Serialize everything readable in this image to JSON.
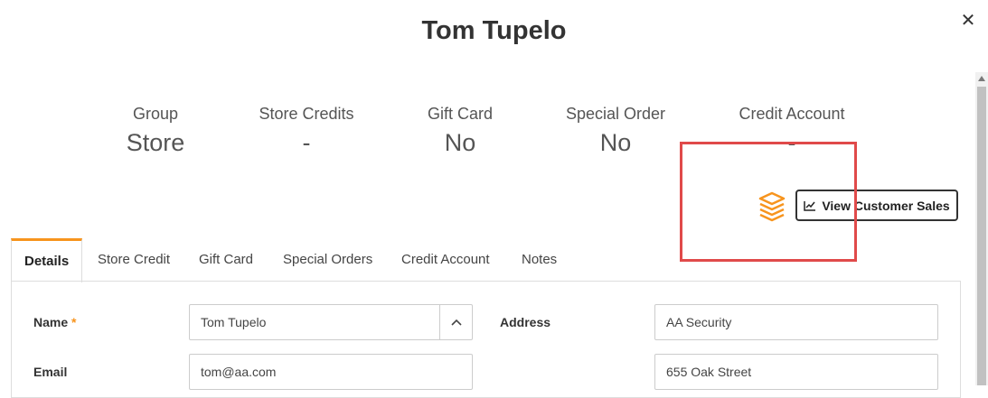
{
  "modal": {
    "title": "Tom Tupelo",
    "close_label": "✕"
  },
  "stats": [
    {
      "label": "Group",
      "value": "Store"
    },
    {
      "label": "Store Credits",
      "value": "-"
    },
    {
      "label": "Gift Card",
      "value": "No"
    },
    {
      "label": "Special Order",
      "value": "No"
    },
    {
      "label": "Credit Account",
      "value": "-"
    }
  ],
  "actions": {
    "view_sales_label": "View Customer Sales",
    "brand_icon": "layered-stack-icon"
  },
  "tabs": [
    {
      "label": "Details",
      "active": true
    },
    {
      "label": "Store Credit"
    },
    {
      "label": "Gift Card"
    },
    {
      "label": "Special Orders"
    },
    {
      "label": "Credit Account"
    },
    {
      "label": "Notes"
    }
  ],
  "details": {
    "name_label": "Name",
    "required_marker": "*",
    "name_value": "Tom Tupelo",
    "email_label": "Email",
    "email_value": "tom@aa.com",
    "address_label": "Address",
    "address_line1": "AA Security",
    "address_line2": "655 Oak Street"
  },
  "colors": {
    "accent": "#f7941d",
    "highlight": "#e04a4a",
    "text": "#333333"
  }
}
